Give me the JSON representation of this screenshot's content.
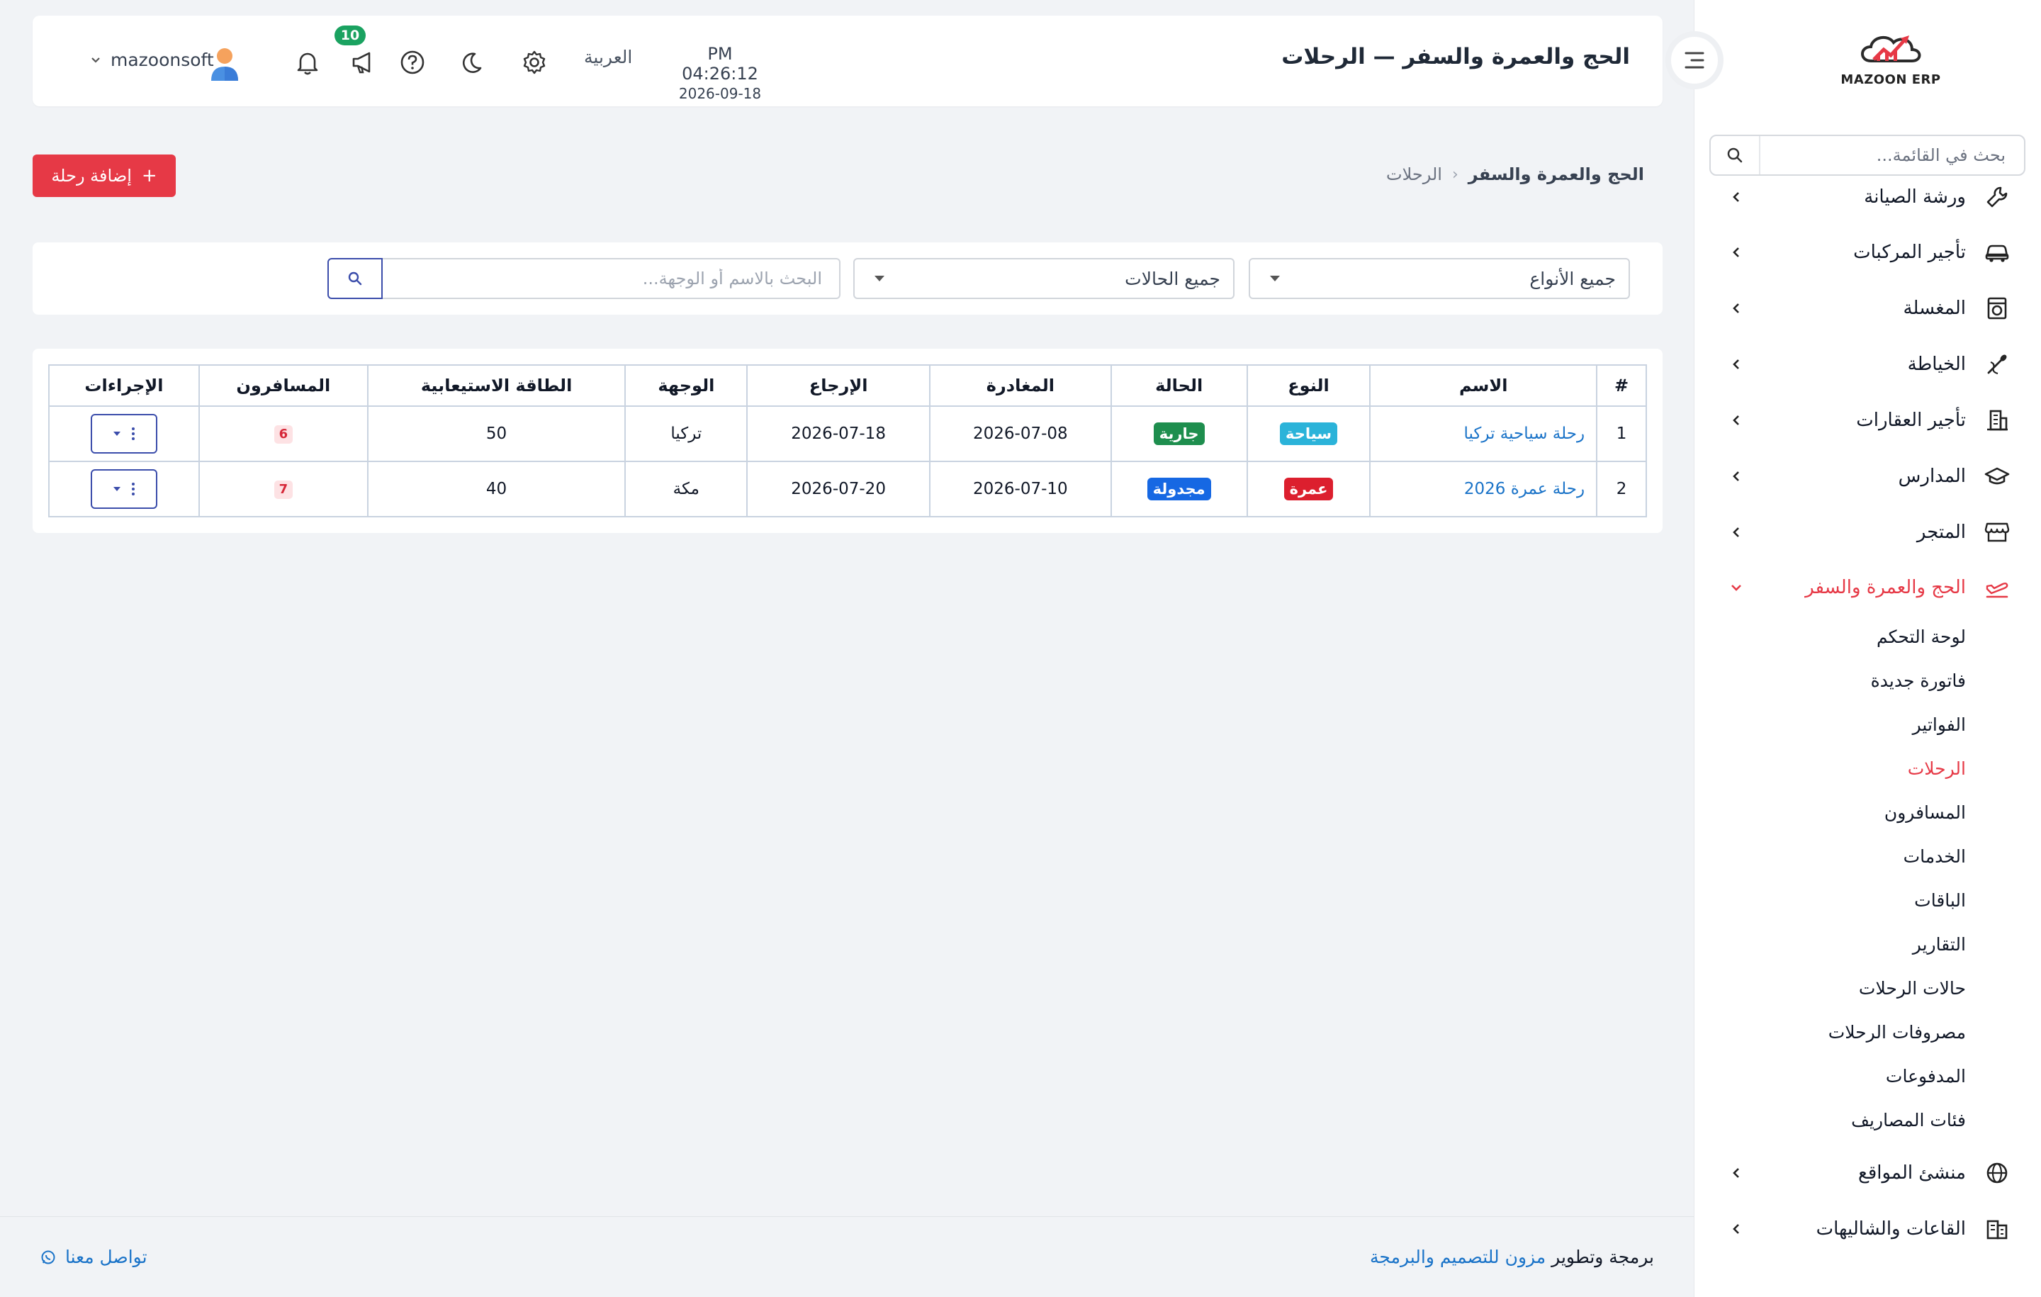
{
  "brand": {
    "logo_text": "MAZOON ERP"
  },
  "sidebar": {
    "search_placeholder": "بحث في القائمة...",
    "items": [
      {
        "label": "ورشة الصيانة",
        "icon": "wrench-icon"
      },
      {
        "label": "تأجير المركبات",
        "icon": "car-icon"
      },
      {
        "label": "المغسلة",
        "icon": "washing-machine-icon"
      },
      {
        "label": "الخياطة",
        "icon": "needle-icon"
      },
      {
        "label": "تأجير العقارات",
        "icon": "building-icon"
      },
      {
        "label": "المدارس",
        "icon": "graduation-cap-icon"
      },
      {
        "label": "المتجر",
        "icon": "store-icon"
      },
      {
        "label": "الحج والعمرة والسفر",
        "icon": "plane-icon",
        "active": true
      },
      {
        "label": "منشئ المواقع",
        "icon": "globe-icon"
      },
      {
        "label": "القاعات والشاليهات",
        "icon": "hall-icon"
      }
    ],
    "sub_items": [
      {
        "label": "لوحة التحكم"
      },
      {
        "label": "فاتورة جديدة"
      },
      {
        "label": "الفواتير"
      },
      {
        "label": "الرحلات",
        "active": true
      },
      {
        "label": "المسافرون"
      },
      {
        "label": "الخدمات"
      },
      {
        "label": "الباقات"
      },
      {
        "label": "التقارير"
      },
      {
        "label": "حالات الرحلات"
      },
      {
        "label": "مصروفات الرحلات"
      },
      {
        "label": "المدفوعات"
      },
      {
        "label": "فئات المصاريف"
      }
    ]
  },
  "header": {
    "title": "الحج والعمرة والسفر — الرحلات",
    "time": "PM 04:26:12",
    "date": "2026-09-18",
    "language": "العربية",
    "notification_count": "10",
    "username": "mazoonsoft"
  },
  "breadcrumb": {
    "root": "الحج والعمرة والسفر",
    "current": "الرحلات"
  },
  "actions": {
    "add_trip": "إضافة رحلة"
  },
  "filters": {
    "type_value": "جميع الأنواع",
    "status_value": "جميع الحالات",
    "search_placeholder": "البحث بالاسم أو الوجهة..."
  },
  "table": {
    "headers": [
      "#",
      "الاسم",
      "النوع",
      "الحالة",
      "المغادرة",
      "الإرجاع",
      "الوجهة",
      "الطاقة الاستيعابية",
      "المسافرون",
      "الإجراءات"
    ],
    "rows": [
      {
        "num": "1",
        "name": "رحلة سياحية تركيا",
        "type": "سياحة",
        "type_color": "#2bb3d9",
        "status": "جارية",
        "status_color": "#1e8e4e",
        "departure": "2026-07-08",
        "return": "2026-07-18",
        "destination": "تركيا",
        "capacity": "50",
        "travelers": "6"
      },
      {
        "num": "2",
        "name": "رحلة عمرة 2026",
        "type": "عمرة",
        "type_color": "#dc1f2e",
        "status": "مجدولة",
        "status_color": "#1668e3",
        "departure": "2026-07-10",
        "return": "2026-07-20",
        "destination": "مكة",
        "capacity": "40",
        "travelers": "7"
      }
    ]
  },
  "footer": {
    "credit_prefix": "برمجة وتطوير",
    "credit_brand": "مزون للتصميم والبرمجة",
    "contact": "تواصل معنا"
  },
  "colors": {
    "accent": "#e63946",
    "link": "#1a73c8",
    "primary_outline": "#3b4dab"
  }
}
